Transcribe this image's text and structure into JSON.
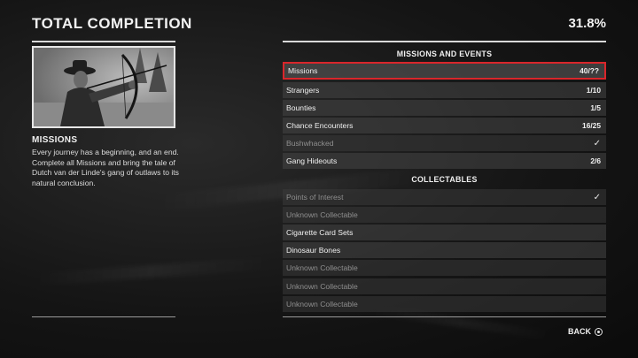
{
  "header": {
    "title": "TOTAL COMPLETION",
    "percent": "31.8%"
  },
  "detail": {
    "title": "MISSIONS",
    "body": "Every journey has a beginning, and an end. Complete all Missions and bring the tale of Dutch van der Linde's gang of outlaws to its natural conclusion."
  },
  "sections": [
    {
      "title": "MISSIONS AND EVENTS",
      "rows": [
        {
          "label": "Missions",
          "value": "40/??",
          "selected": true,
          "dim": false
        },
        {
          "label": "Strangers",
          "value": "1/10",
          "selected": false,
          "dim": false
        },
        {
          "label": "Bounties",
          "value": "1/5",
          "selected": false,
          "dim": false
        },
        {
          "label": "Chance Encounters",
          "value": "16/25",
          "selected": false,
          "dim": false
        },
        {
          "label": "Bushwhacked",
          "value": "✓",
          "selected": false,
          "dim": true
        },
        {
          "label": "Gang Hideouts",
          "value": "2/6",
          "selected": false,
          "dim": false
        }
      ]
    },
    {
      "title": "COLLECTABLES",
      "rows": [
        {
          "label": "Points of Interest",
          "value": "✓",
          "selected": false,
          "dim": true
        },
        {
          "label": "Unknown Collectable",
          "value": "",
          "selected": false,
          "dim": true
        },
        {
          "label": "Cigarette Card Sets",
          "value": "",
          "selected": false,
          "dim": false
        },
        {
          "label": "Dinosaur Bones",
          "value": "",
          "selected": false,
          "dim": false
        },
        {
          "label": "Unknown Collectable",
          "value": "",
          "selected": false,
          "dim": true
        },
        {
          "label": "Unknown Collectable",
          "value": "",
          "selected": false,
          "dim": true
        },
        {
          "label": "Unknown Collectable",
          "value": "",
          "selected": false,
          "dim": true
        }
      ]
    }
  ],
  "footer": {
    "back_label": "BACK",
    "back_icon": "circle-button-icon"
  },
  "colors": {
    "selected_border": "#d9262b",
    "text": "#f0f0f0",
    "dim_text": "#8f8f8f"
  }
}
